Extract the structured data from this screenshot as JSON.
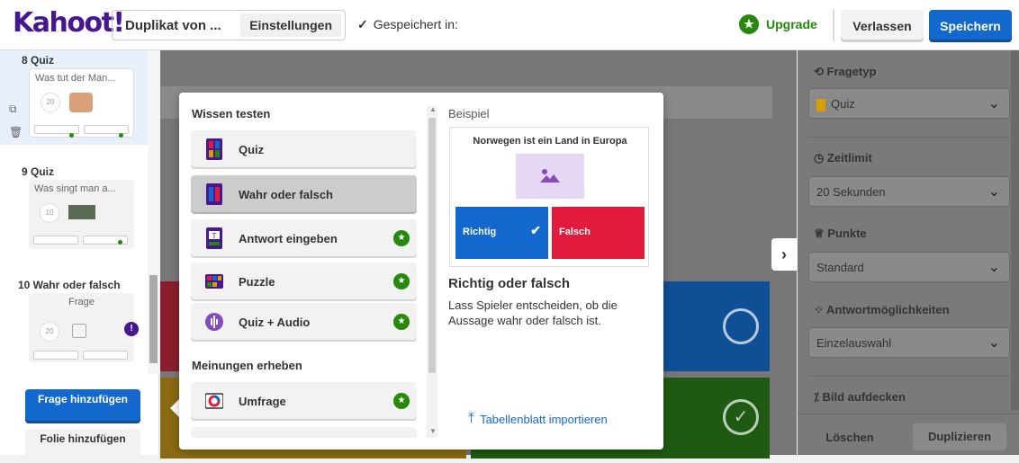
{
  "header": {
    "logo": "Kahoot!",
    "title": "Duplikat von ...",
    "settings_label": "Einstellungen",
    "saved_text": "Gespeichert in:",
    "upgrade_label": "Upgrade",
    "leave_label": "Verlassen",
    "save_label": "Speichern"
  },
  "sidebar": {
    "slides": [
      {
        "label": "8  Quiz",
        "question": "Was tut der Man...",
        "time": "20"
      },
      {
        "label": "9  Quiz",
        "question": "Was singt man a...",
        "time": "10"
      },
      {
        "label": "10  Wahr oder falsch",
        "question": "Frage",
        "time": "20"
      }
    ],
    "add_question_label": "Frage hinzufügen",
    "add_slide_label": "Folie hinzufügen"
  },
  "modal": {
    "section1": "Wissen testen",
    "section2": "Meinungen erheben",
    "types": [
      {
        "label": "Quiz",
        "premium": false,
        "selected": false
      },
      {
        "label": "Wahr oder falsch",
        "premium": false,
        "selected": true
      },
      {
        "label": "Antwort eingeben",
        "premium": true,
        "selected": false
      },
      {
        "label": "Puzzle",
        "premium": true,
        "selected": false
      },
      {
        "label": "Quiz + Audio",
        "premium": true,
        "selected": false
      }
    ],
    "opinion_types": [
      {
        "label": "Umfrage",
        "premium": true
      }
    ],
    "example": {
      "label": "Beispiel",
      "question": "Norwegen ist ein Land in Europa",
      "true_label": "Richtig",
      "false_label": "Falsch",
      "name": "Richtig oder falsch",
      "description": "Lass Spieler entscheiden, ob die Aussage wahr oder falsch ist."
    },
    "import_label": "Tabellenblatt importieren"
  },
  "right_panel": {
    "question_type_label": "Fragetyp",
    "question_type_value": "Quiz",
    "time_limit_label": "Zeitlimit",
    "time_limit_value": "20 Sekunden",
    "points_label": "Punkte",
    "points_value": "Standard",
    "answer_options_label": "Antwortmöglichkeiten",
    "answer_options_value": "Einzelauswahl",
    "reveal_image_label": "Bild aufdecken",
    "delete_label": "Löschen",
    "duplicate_label": "Duplizieren"
  },
  "colors": {
    "brand": "#46178f",
    "primary": "#1368ce",
    "red": "#e21b3c",
    "green": "#26890c",
    "yellow": "#d89e00"
  }
}
